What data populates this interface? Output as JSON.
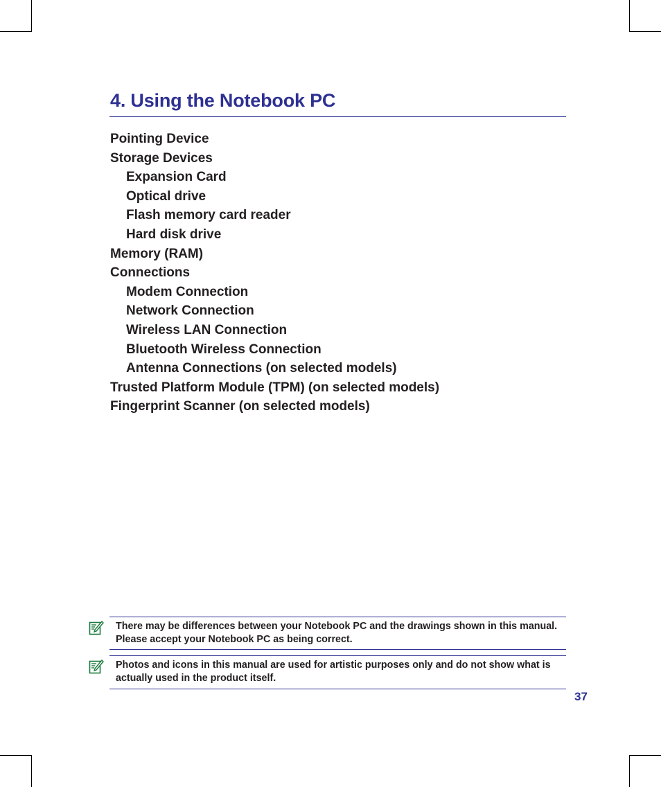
{
  "page": {
    "chapter_title": "4. Using the Notebook PC",
    "page_number": "37",
    "accent_color": "#2e3192",
    "note_icon_color": "#1a7a3a"
  },
  "toc": [
    {
      "label": "Pointing Device",
      "level": 1
    },
    {
      "label": "Storage Devices",
      "level": 1
    },
    {
      "label": "Expansion Card",
      "level": 2
    },
    {
      "label": "Optical drive",
      "level": 2
    },
    {
      "label": "Flash memory card reader",
      "level": 2
    },
    {
      "label": "Hard disk drive",
      "level": 2
    },
    {
      "label": "Memory (RAM)",
      "level": 1
    },
    {
      "label": "Connections",
      "level": 1
    },
    {
      "label": "Modem Connection",
      "level": 2
    },
    {
      "label": "Network Connection",
      "level": 2
    },
    {
      "label": "Wireless LAN Connection",
      "level": 2
    },
    {
      "label": "Bluetooth Wireless Connection",
      "level": 2
    },
    {
      "label": "Antenna Connections (on selected models)",
      "level": 2
    },
    {
      "label": "Trusted Platform Module (TPM) (on selected models)",
      "level": 1
    },
    {
      "label": "Fingerprint Scanner (on selected models)",
      "level": 1
    }
  ],
  "notes": [
    {
      "icon": "note-pencil-icon",
      "text": "There may be differences between your Notebook PC and the drawings shown in this manual. Please accept your Notebook PC as being correct."
    },
    {
      "icon": "note-pencil-icon",
      "text": "Photos and icons in this manual are used for artistic purposes only and do not show what is actually used in the product itself."
    }
  ]
}
